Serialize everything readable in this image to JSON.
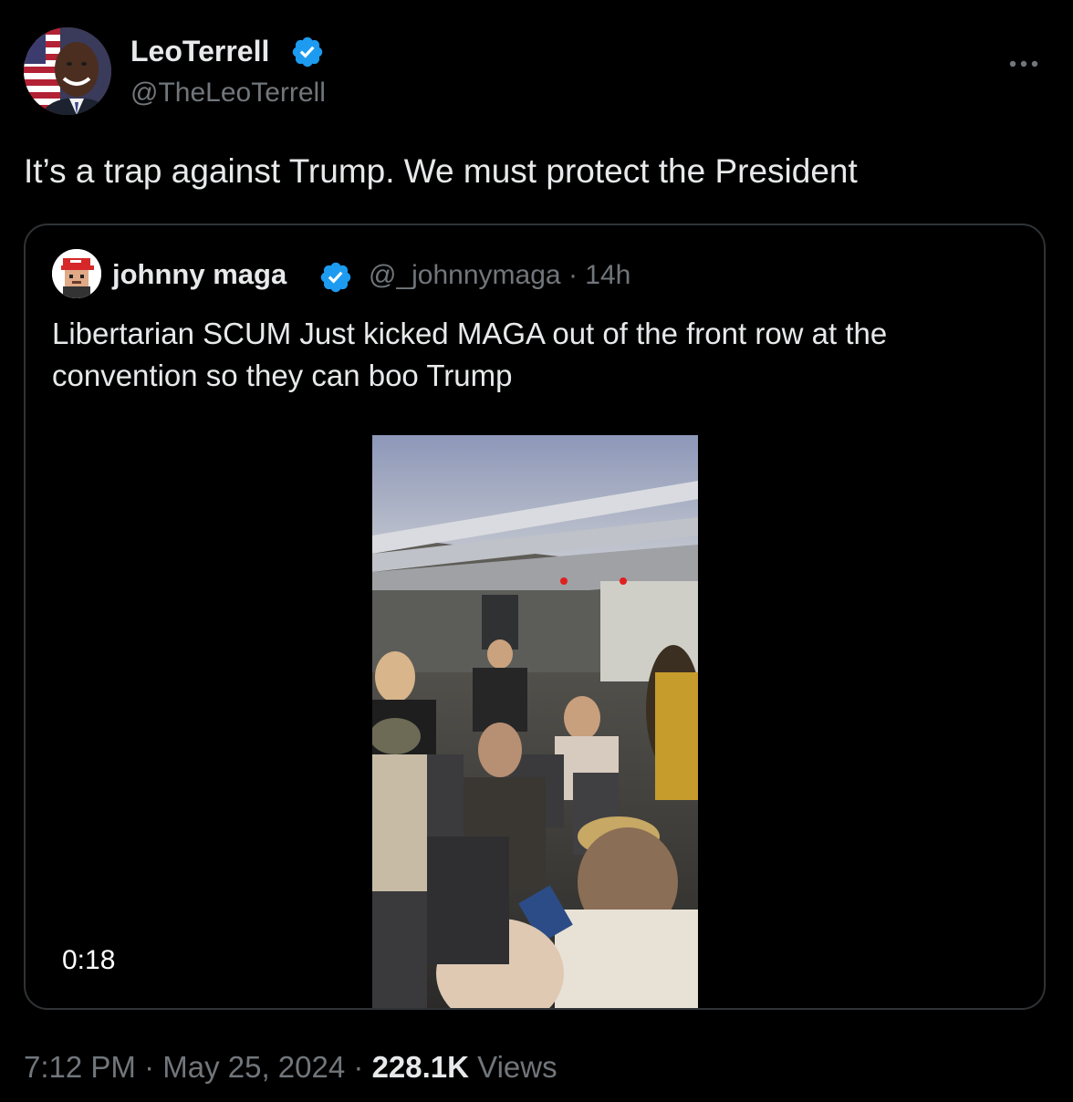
{
  "author": {
    "display_name": "LeoTerrell",
    "handle": "@TheLeoTerrell",
    "verified": true,
    "avatar_icon": "profile-photo-icon"
  },
  "tweet": {
    "text": "It’s a trap against Trump. We must protect the President"
  },
  "quoted_tweet": {
    "display_name": "johnny maga",
    "handle": "@_johnnymaga",
    "separator": "·",
    "time": "14h",
    "text": "Libertarian SCUM Just kicked MAGA out of the front row at the convention so they can boo Trump",
    "video_duration": "0:18"
  },
  "meta": {
    "time": "7:12 PM",
    "sep1": "·",
    "date": "May 25, 2024",
    "sep2": "·",
    "views_count": "228.1K",
    "views_label": "Views"
  },
  "icons": {
    "more": "more-dots-icon",
    "verified": "verified-badge-icon"
  },
  "colors": {
    "background": "#000000",
    "text": "#e7e9ea",
    "secondary": "#71767b",
    "border": "#2f3336",
    "verified_blue": "#1d9bf0"
  }
}
